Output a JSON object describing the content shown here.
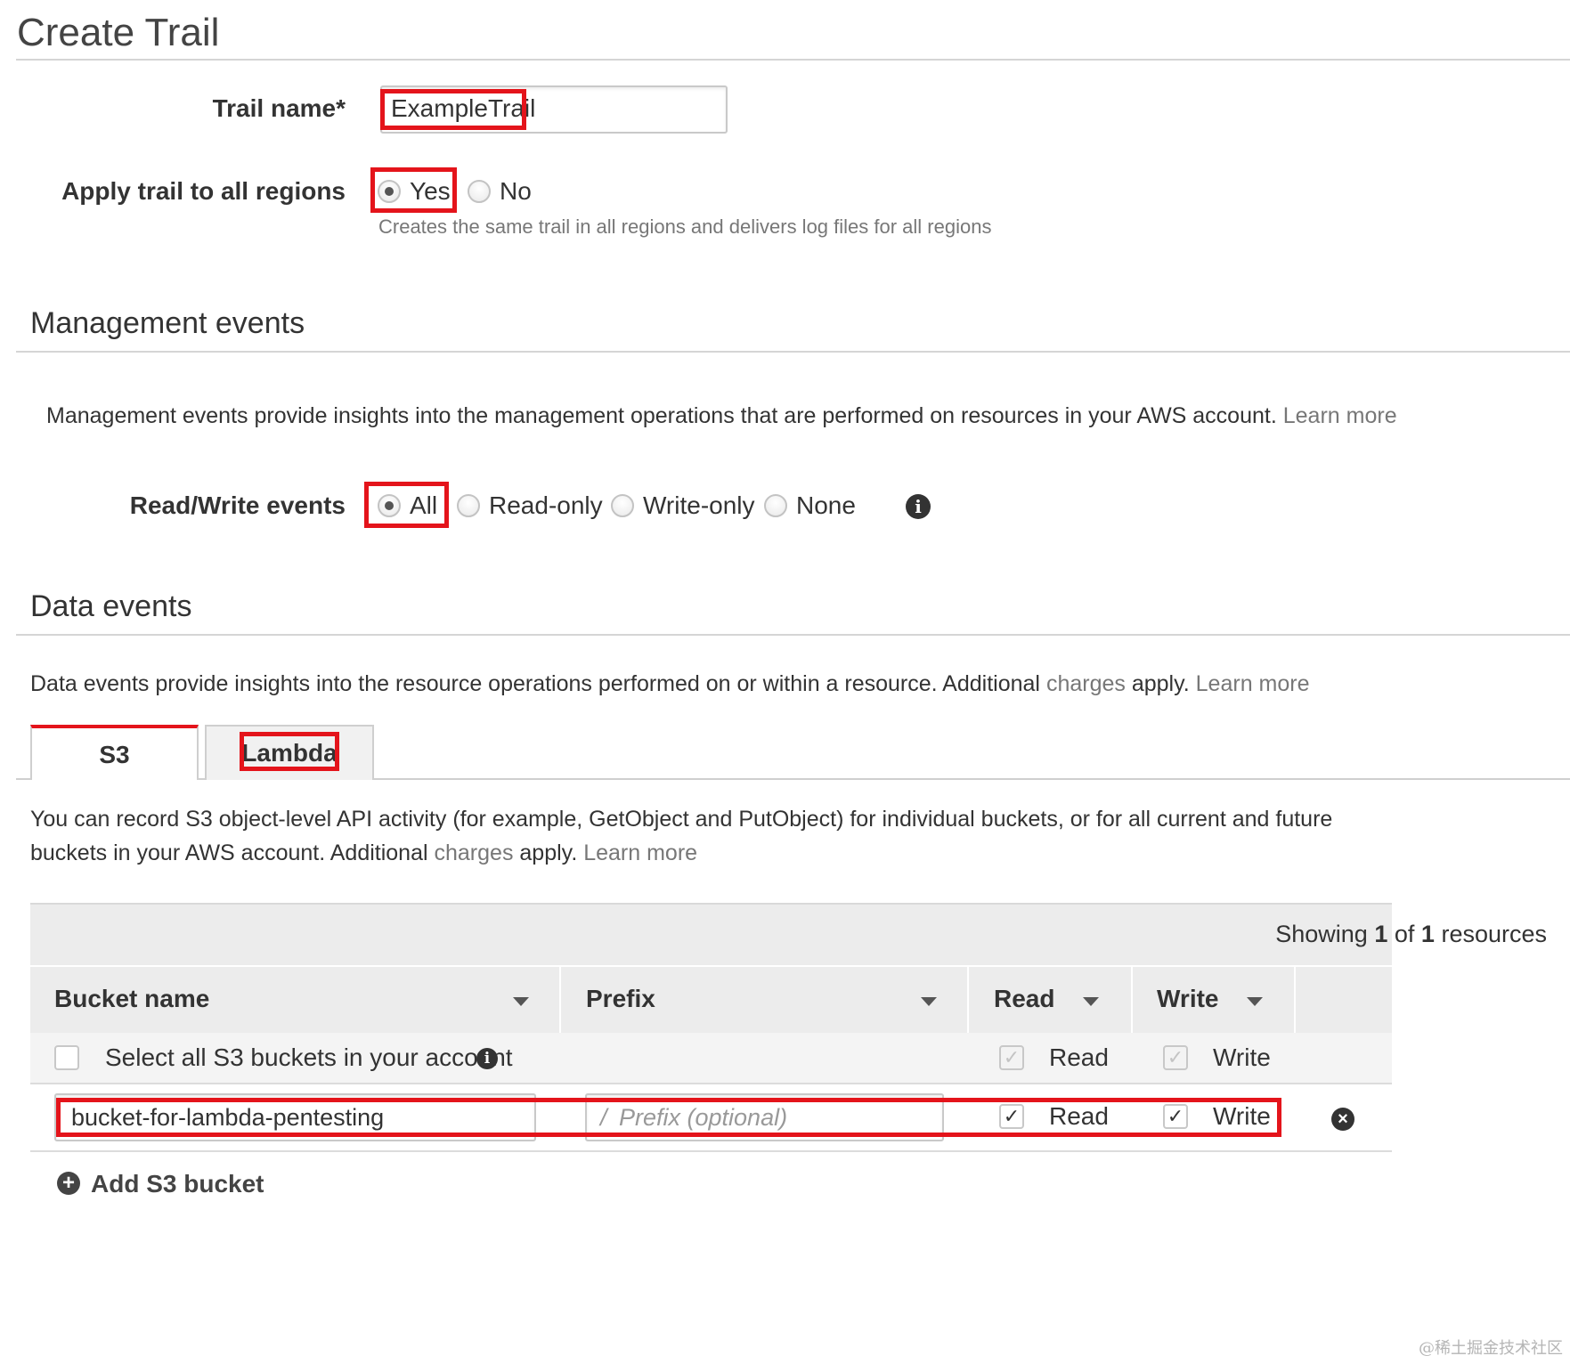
{
  "page": {
    "title": "Create Trail"
  },
  "trail_name": {
    "label": "Trail name*",
    "value": "ExampleTrail"
  },
  "apply_all_regions": {
    "label": "Apply trail to all regions",
    "options": [
      "Yes",
      "No"
    ],
    "selected": "Yes",
    "help": "Creates the same trail in all regions and delivers log files for all regions"
  },
  "management_events": {
    "title": "Management events",
    "description": "Management events provide insights into the management operations that are performed on resources in your AWS account.",
    "learn_more": "Learn more",
    "rw_label": "Read/Write events",
    "rw_options": [
      "All",
      "Read-only",
      "Write-only",
      "None"
    ],
    "rw_selected": "All"
  },
  "data_events": {
    "title": "Data events",
    "description": "Data events provide insights into the resource operations performed on or within a resource. Additional",
    "charges": "charges",
    "apply": "apply.",
    "learn_more": "Learn more",
    "tabs": [
      "S3",
      "Lambda"
    ],
    "active_tab": "S3",
    "s3_desc_line1": "You can record S3 object-level API activity (for example, GetObject and PutObject) for individual buckets, or for all current and future",
    "s3_desc_line2_a": "buckets in your AWS account. Additional",
    "s3_desc_charges": "charges",
    "s3_desc_apply": "apply.",
    "s3_desc_learn": "Learn more"
  },
  "table": {
    "showing_prefix": "Showing",
    "showing_count": "1",
    "showing_of": "of",
    "showing_total": "1",
    "showing_suffix": "resources",
    "columns": [
      "Bucket name",
      "Prefix",
      "Read",
      "Write"
    ],
    "select_all_label": "Select all S3 buckets in your account",
    "select_all_checked": false,
    "select_all_read": "Read",
    "select_all_write": "Write",
    "row": {
      "bucket": "bucket-for-lambda-pentesting",
      "prefix_slash": "/",
      "prefix_placeholder": "Prefix (optional)",
      "read_label": "Read",
      "write_label": "Write",
      "read_checked": true,
      "write_checked": true
    },
    "add_label": "Add S3 bucket"
  },
  "colors": {
    "highlight": "#e4141b",
    "tab_accent": "#e4141b",
    "muted": "#777777"
  },
  "watermark": "@稀土掘金技术社区"
}
